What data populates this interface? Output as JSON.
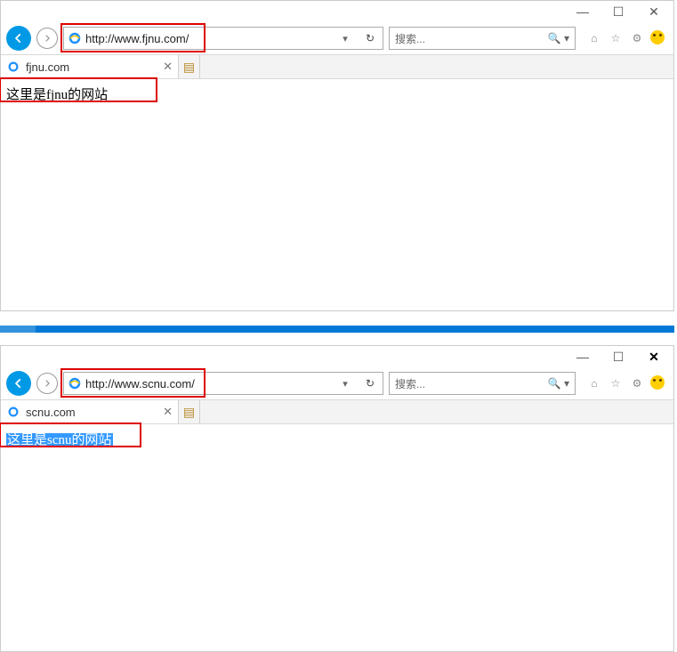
{
  "window1": {
    "titlebar": {
      "minimize": "—",
      "maximize": "☐",
      "close": "✕"
    },
    "nav": {
      "back": "←",
      "forward": "→"
    },
    "address": {
      "url": "http://www.fjnu.com/",
      "dropdown": "▾",
      "refresh": "↻"
    },
    "search": {
      "placeholder": "搜索...",
      "icon": "🔍",
      "drop": "▾"
    },
    "right_icons": {
      "home": "⌂",
      "star": "☆",
      "gear": "⚙"
    },
    "tab": {
      "title": "fjnu.com",
      "close": "✕",
      "newtab": "▤"
    },
    "page": {
      "text": "这里是fjnu的网站"
    },
    "highlight": {
      "addr_box": true,
      "page_box": true
    }
  },
  "window2": {
    "titlebar": {
      "minimize": "—",
      "maximize": "☐",
      "close": "✕"
    },
    "nav": {
      "back": "←",
      "forward": "→"
    },
    "address": {
      "url": "http://www.scnu.com/",
      "dropdown": "▾",
      "refresh": "↻"
    },
    "search": {
      "placeholder": "搜索...",
      "icon": "🔍",
      "drop": "▾"
    },
    "right_icons": {
      "home": "⌂",
      "star": "☆",
      "gear": "⚙"
    },
    "tab": {
      "title": "scnu.com",
      "close": "✕",
      "newtab": "▤"
    },
    "page": {
      "text": "这里是scnu的网站"
    },
    "highlight": {
      "addr_box": true,
      "page_box": true
    }
  }
}
